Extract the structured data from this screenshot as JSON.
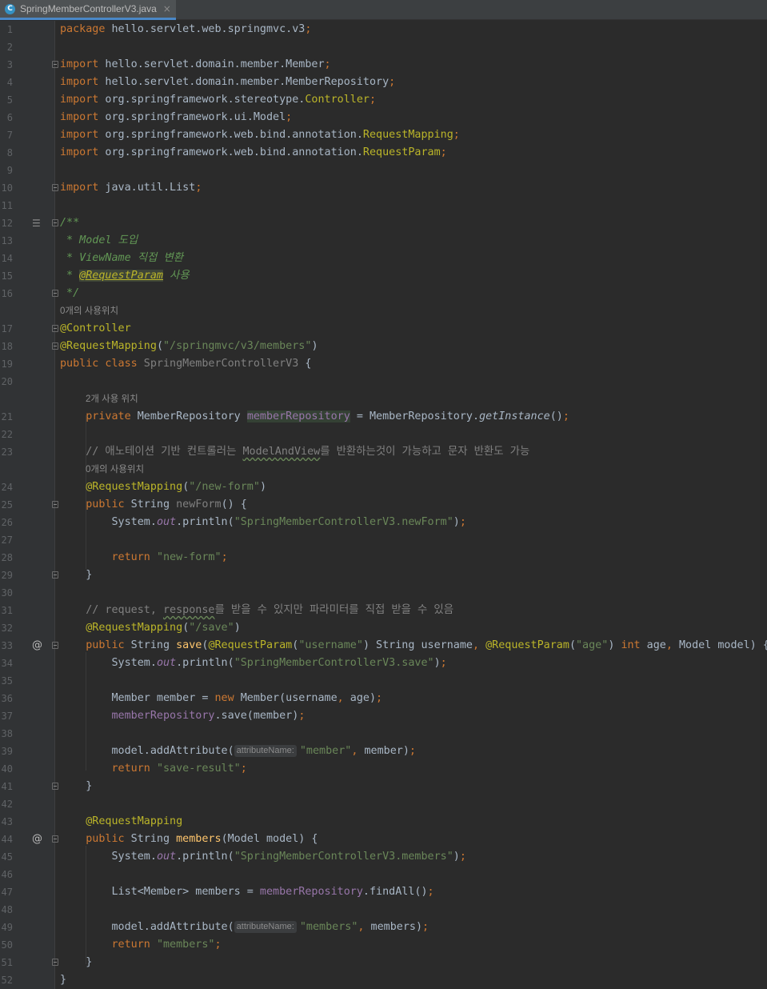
{
  "tab": {
    "file_icon": "C",
    "filename": "SpringMemberControllerV3.java",
    "close": "×"
  },
  "usages": {
    "u1": "0개의 사용위치",
    "u2": "2개 사용 위치",
    "u3": "0개의 사용위치"
  },
  "hints": {
    "attr1": "attributeName:",
    "attr2": "attributeName:"
  },
  "gutter_icons": [
    "javadoc-render-icon",
    "override-at-icon",
    "override-at-icon"
  ],
  "code": {
    "l1": [
      "package",
      " hello.servlet.web.springmvc.v3",
      ";"
    ],
    "l3": [
      "import",
      " hello.servlet.domain.member.Member",
      ";"
    ],
    "l4": [
      "import",
      " hello.servlet.domain.member.MemberRepository",
      ";"
    ],
    "l5": [
      "import",
      " org.springframework.stereotype.",
      "Controller",
      ";"
    ],
    "l6": [
      "import",
      " org.springframework.ui.Model",
      ";"
    ],
    "l7": [
      "import",
      " org.springframework.web.bind.annotation.",
      "RequestMapping",
      ";"
    ],
    "l8": [
      "import",
      " org.springframework.web.bind.annotation.",
      "RequestParam",
      ";"
    ],
    "l10": [
      "import",
      " java.util.List",
      ";"
    ],
    "l12": [
      "/**"
    ],
    "l13": [
      " * Model 도입"
    ],
    "l14": [
      " * ViewName 직접 변환"
    ],
    "l15": [
      " * ",
      "@RequestParam",
      " 사용"
    ],
    "l16": [
      " */"
    ],
    "l17": [
      "@Controller"
    ],
    "l18": [
      "@RequestMapping",
      "(",
      "\"/springmvc/v3/members\"",
      ")"
    ],
    "l19": [
      "public class",
      " SpringMemberControllerV3",
      " {"
    ],
    "l21": [
      "    private",
      " MemberRepository ",
      "memberRepository",
      " = MemberRepository.",
      "getInstance",
      "()",
      ";"
    ],
    "l23": [
      "    // 애노테이션 기반 컨트롤러는 ",
      "ModelAndView",
      "를 반환하는것이 가능하고 문자 반환도 가능"
    ],
    "l24": [
      "    @RequestMapping",
      "(",
      "\"/new-form\"",
      ")"
    ],
    "l25": [
      "    public",
      " String ",
      "newForm",
      "() {"
    ],
    "l26": [
      "        System.",
      "out",
      ".println(",
      "\"SpringMemberControllerV3.newForm\"",
      ")",
      ";"
    ],
    "l28": [
      "        return ",
      "\"new-form\"",
      ";"
    ],
    "l29": [
      "    }"
    ],
    "l31": [
      "    // request, ",
      "response",
      "를 받을 수 있지만 파라미터를 직접 받을 수 있음"
    ],
    "l32": [
      "    @RequestMapping",
      "(",
      "\"/save\"",
      ")"
    ],
    "l33": [
      "    public",
      " String ",
      "save",
      "(",
      "@RequestParam",
      "(",
      "\"username\"",
      ") String username",
      ", ",
      "@RequestParam",
      "(",
      "\"age\"",
      ") ",
      "int",
      " age",
      ", ",
      "Model model) {"
    ],
    "l34": [
      "        System.",
      "out",
      ".println(",
      "\"SpringMemberControllerV3.save\"",
      ")",
      ";"
    ],
    "l36": [
      "        Member member = ",
      "new",
      " Member(username",
      ", ",
      "age)",
      ";"
    ],
    "l37": [
      "        ",
      "memberRepository",
      ".save(member)",
      ";"
    ],
    "l39": [
      "        model.addAttribute(",
      "\"member\"",
      ", ",
      "member)",
      ";"
    ],
    "l40": [
      "        return ",
      "\"save-result\"",
      ";"
    ],
    "l41": [
      "    }"
    ],
    "l43": [
      "    @RequestMapping"
    ],
    "l44": [
      "    public",
      " String ",
      "members",
      "(Model model) {"
    ],
    "l45": [
      "        System.",
      "out",
      ".println(",
      "\"SpringMemberControllerV3.members\"",
      ")",
      ";"
    ],
    "l47": [
      "        List<Member> members = ",
      "memberRepository",
      ".findAll()",
      ";"
    ],
    "l49": [
      "        model.addAttribute(",
      "\"members\"",
      ", ",
      "members)",
      ";"
    ],
    "l50": [
      "        return ",
      "\"members\"",
      ";"
    ],
    "l51": [
      "    }"
    ],
    "l52": [
      "}"
    ]
  },
  "colors": {
    "background": "#2b2b2b",
    "keyword": "#cc7832",
    "annotation": "#bbb529",
    "string": "#6a8759",
    "comment": "#808080",
    "field": "#9876aa",
    "method": "#ffc66d",
    "text": "#a9b7c6"
  }
}
